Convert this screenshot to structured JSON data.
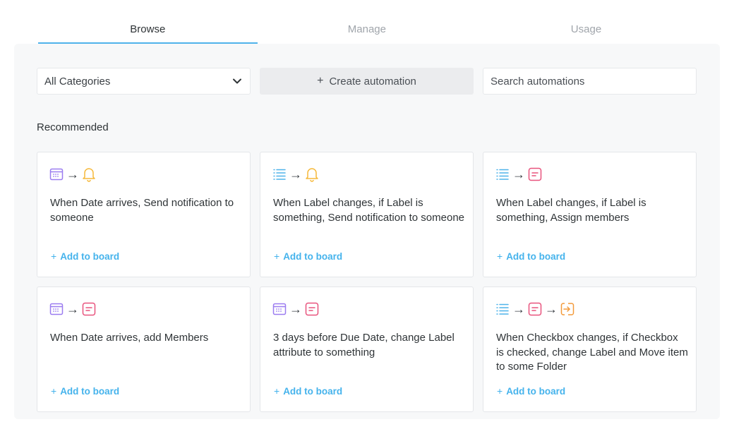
{
  "tabs": [
    {
      "label": "Browse",
      "active": true
    },
    {
      "label": "Manage",
      "active": false
    },
    {
      "label": "Usage",
      "active": false
    }
  ],
  "toolbar": {
    "category_value": "All Categories",
    "create_label": "Create automation",
    "search_placeholder": "Search automations"
  },
  "section": {
    "title": "Recommended"
  },
  "add_label": "Add to board",
  "cards": [
    {
      "icons": [
        "calendar-icon",
        "bell-icon"
      ],
      "text": "When Date arrives, Send notification to someone"
    },
    {
      "icons": [
        "list-icon",
        "bell-icon"
      ],
      "text": "When Label changes, if Label is something, Send notification to someone"
    },
    {
      "icons": [
        "list-icon",
        "form-icon"
      ],
      "text": "When Label changes, if Label is something, Assign members"
    },
    {
      "icons": [
        "calendar-icon",
        "form-icon"
      ],
      "text": "When Date arrives, add Members"
    },
    {
      "icons": [
        "calendar-icon",
        "form-icon"
      ],
      "text": "3 days before Due Date, change Label attribute to something"
    },
    {
      "icons": [
        "list-icon",
        "form-icon",
        "move-icon"
      ],
      "text": "When Checkbox changes, if Checkbox is checked, change Label and Move item to some Folder"
    }
  ],
  "colors": {
    "accent": "#4fb3ea",
    "link": "#45b3ec",
    "calendar": "#9b7cf0",
    "bell": "#f6b93b",
    "list": "#4fb3ea",
    "form": "#e8537d",
    "move": "#f39a3a"
  }
}
